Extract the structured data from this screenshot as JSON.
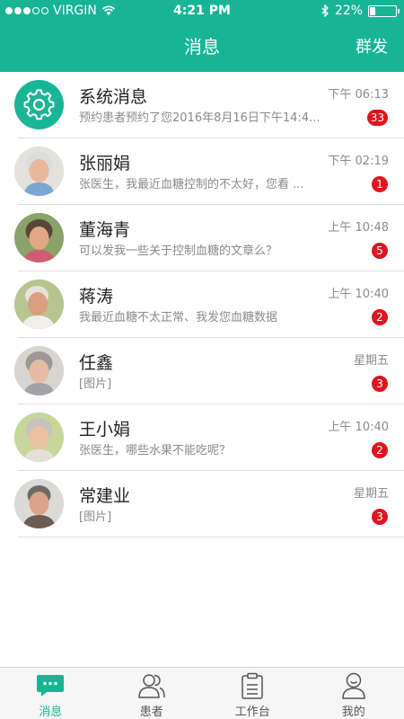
{
  "status_bar": {
    "carrier": "VIRGIN",
    "time": "4:21 PM",
    "battery": "22%",
    "battery_level": 0.22
  },
  "nav": {
    "title": "消息",
    "action_label": "群发"
  },
  "messages": [
    {
      "name": "系统消息",
      "preview": "预约患者预约了您2016年8月16日下午14:4...",
      "time": "下午 06:13",
      "badge": "33",
      "avatar": "gear-icon"
    },
    {
      "name": "张丽娟",
      "preview": "张医生，我最近血糖控制的不太好，您看 ...",
      "time": "下午 02:19",
      "badge": "1",
      "avatar": "photo"
    },
    {
      "name": "董海青",
      "preview": "可以发我一些关于控制血糖的文章么？",
      "time": "上午 10:48",
      "badge": "5",
      "avatar": "photo"
    },
    {
      "name": "蒋涛",
      "preview": "我最近血糖不太正常、我发您血糖数据",
      "time": "上午 10:40",
      "badge": "2",
      "avatar": "photo"
    },
    {
      "name": "任鑫",
      "preview": "[图片]",
      "time": "星期五",
      "badge": "3",
      "avatar": "photo"
    },
    {
      "name": "王小娟",
      "preview": "张医生，哪些水果不能吃呢？",
      "time": "上午 10:40",
      "badge": "2",
      "avatar": "photo"
    },
    {
      "name": "常建业",
      "preview": "[图片]",
      "time": "星期五",
      "badge": "3",
      "avatar": "photo"
    }
  ],
  "tabs": [
    {
      "label": "消息",
      "icon": "chat-bubble-icon",
      "active": true
    },
    {
      "label": "患者",
      "icon": "patients-icon",
      "active": false
    },
    {
      "label": "工作台",
      "icon": "clipboard-icon",
      "active": false
    },
    {
      "label": "我的",
      "icon": "profile-icon",
      "active": false
    }
  ],
  "colors": {
    "brand": "#17b596",
    "badge": "#e0141e"
  }
}
